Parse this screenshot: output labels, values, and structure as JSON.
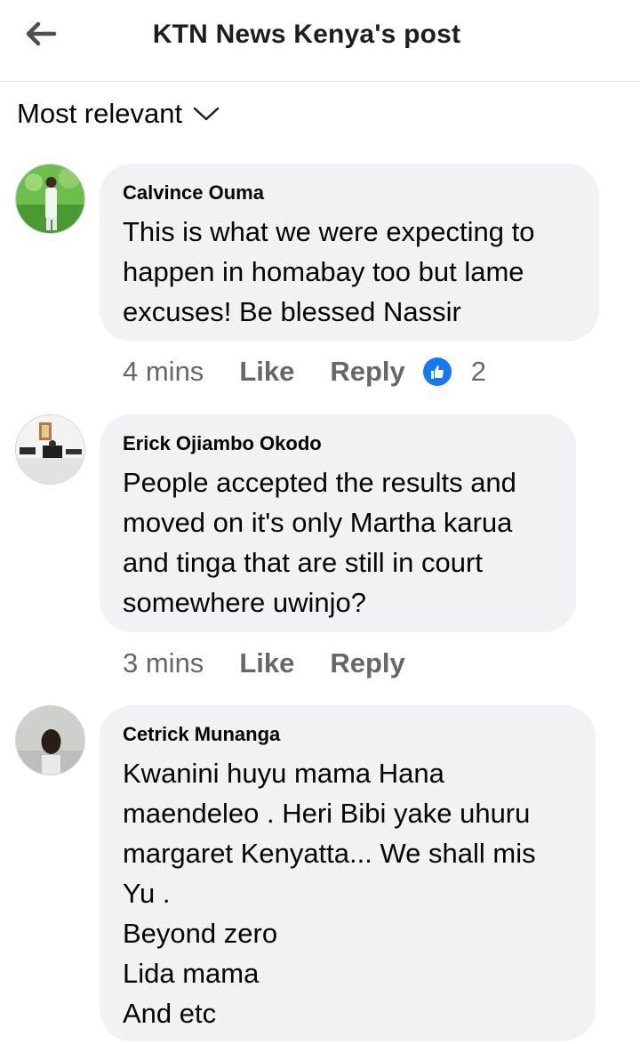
{
  "header": {
    "title": "KTN News Kenya's post",
    "back_icon": "arrow-left-icon"
  },
  "sort": {
    "label": "Most relevant",
    "icon": "chevron-down-icon"
  },
  "colors": {
    "bubble": "#f0f2f5",
    "meta": "#65676b",
    "like_blue": "#1877f2"
  },
  "comments": [
    {
      "author": "Calvince Ouma",
      "text": "This is what we were expecting to\nhappen in homabay too but lame\nexcuses! Be blessed Nassir",
      "time": "4 mins",
      "like": "Like",
      "reply": "Reply",
      "reaction_count": "2"
    },
    {
      "author": "Erick Ojiambo Okodo",
      "text": "People accepted the results and\nmoved on it's only Martha karua\nand tinga that are still  in court\nsomewhere uwinjo?",
      "time": "3 mins",
      "like": "Like",
      "reply": "Reply"
    },
    {
      "author": "Cetrick Munanga",
      "text": "Kwanini huyu mama Hana\nmaendeleo .  Heri Bibi yake uhuru\nmargaret Kenyatta... We shall mis\nYu .\nBeyond zero\nLida mama\nAnd etc"
    }
  ]
}
